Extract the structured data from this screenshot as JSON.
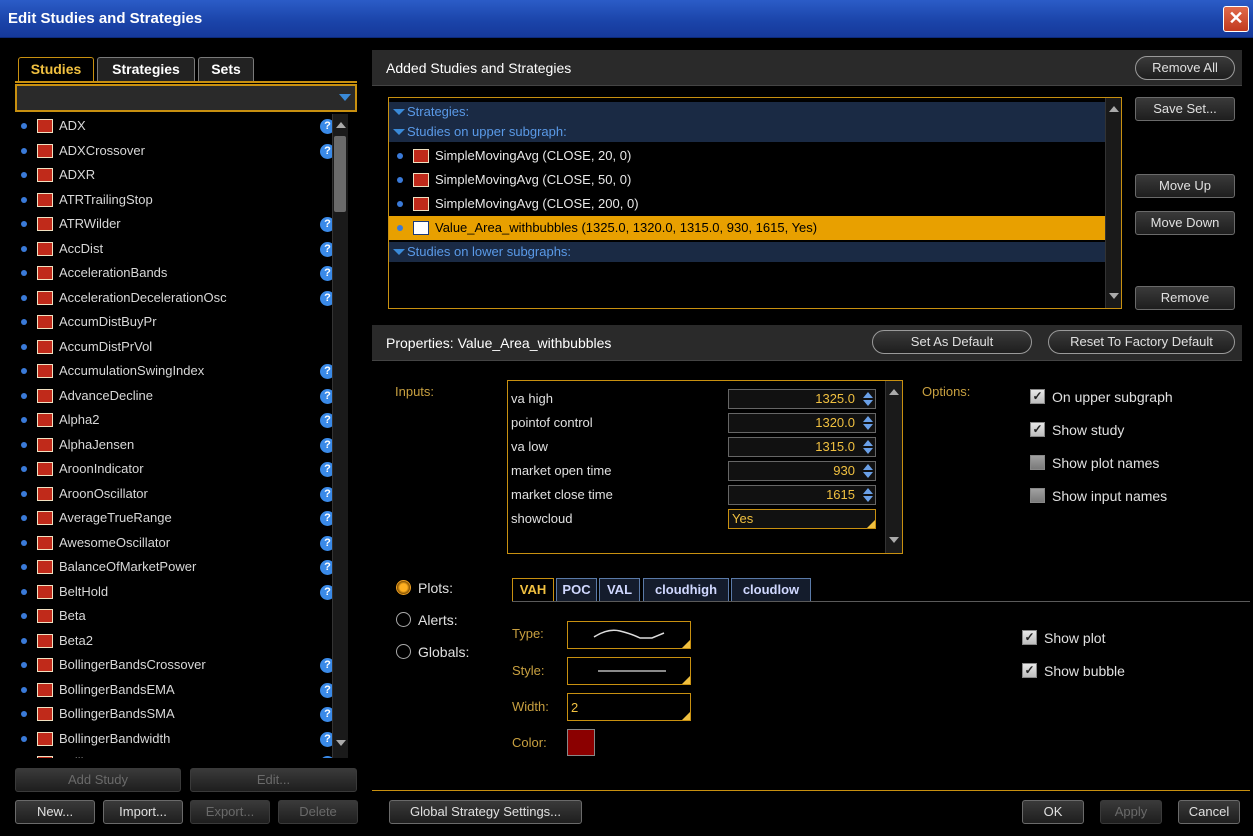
{
  "window": {
    "title": "Edit Studies and Strategies",
    "close_glyph": "✕"
  },
  "left": {
    "tabs": [
      "Studies",
      "Strategies",
      "Sets"
    ],
    "search_value": "",
    "studies": [
      {
        "name": "ADX",
        "help": true
      },
      {
        "name": "ADXCrossover",
        "help": true
      },
      {
        "name": "ADXR",
        "help": false
      },
      {
        "name": "ATRTrailingStop",
        "help": false
      },
      {
        "name": "ATRWilder",
        "help": true
      },
      {
        "name": "AccDist",
        "help": true
      },
      {
        "name": "AccelerationBands",
        "help": true
      },
      {
        "name": "AccelerationDecelerationOsc",
        "help": true
      },
      {
        "name": "AccumDistBuyPr",
        "help": false
      },
      {
        "name": "AccumDistPrVol",
        "help": false
      },
      {
        "name": "AccumulationSwingIndex",
        "help": true
      },
      {
        "name": "AdvanceDecline",
        "help": true
      },
      {
        "name": "Alpha2",
        "help": true
      },
      {
        "name": "AlphaJensen",
        "help": true
      },
      {
        "name": "AroonIndicator",
        "help": true
      },
      {
        "name": "AroonOscillator",
        "help": true
      },
      {
        "name": "AverageTrueRange",
        "help": true
      },
      {
        "name": "AwesomeOscillator",
        "help": true
      },
      {
        "name": "BalanceOfMarketPower",
        "help": true
      },
      {
        "name": "BeltHold",
        "help": true
      },
      {
        "name": "Beta",
        "help": false
      },
      {
        "name": "Beta2",
        "help": false
      },
      {
        "name": "BollingerBandsCrossover",
        "help": true
      },
      {
        "name": "BollingerBandsEMA",
        "help": true
      },
      {
        "name": "BollingerBandsSMA",
        "help": true
      },
      {
        "name": "BollingerBandwidth",
        "help": true
      },
      {
        "name": "BollingerPercentB",
        "help": true
      }
    ],
    "add_study_label": "Add Study",
    "edit_label": "Edit...",
    "new_label": "New...",
    "import_label": "Import...",
    "export_label": "Export...",
    "delete_label": "Delete"
  },
  "added": {
    "header": "Added Studies and Strategies",
    "remove_all": "Remove All",
    "save_set": "Save Set...",
    "move_up": "Move Up",
    "move_down": "Move Down",
    "remove": "Remove",
    "group_strategies": "Strategies:",
    "group_upper": "Studies on upper subgraph:",
    "group_lower": "Studies on lower subgraphs:",
    "items": [
      "SimpleMovingAvg (CLOSE, 20, 0)",
      "SimpleMovingAvg (CLOSE, 50, 0)",
      "SimpleMovingAvg (CLOSE, 200, 0)",
      "Value_Area_withbubbles (1325.0, 1320.0, 1315.0, 930, 1615, Yes)"
    ]
  },
  "properties": {
    "header": "Properties: Value_Area_withbubbles",
    "set_default": "Set As Default",
    "reset_factory": "Reset To Factory Default",
    "inputs_label": "Inputs:",
    "options_label": "Options:",
    "inputs": [
      {
        "name": "va high",
        "value": "1325.0"
      },
      {
        "name": "pointof control",
        "value": "1320.0"
      },
      {
        "name": "va low",
        "value": "1315.0"
      },
      {
        "name": "market open time",
        "value": "930"
      },
      {
        "name": "market close time",
        "value": "1615"
      },
      {
        "name": "showcloud",
        "value": "Yes"
      }
    ],
    "options": [
      {
        "label": "On upper subgraph",
        "checked": true
      },
      {
        "label": "Show study",
        "checked": true
      },
      {
        "label": "Show plot names",
        "checked": false
      },
      {
        "label": "Show input names",
        "checked": false
      }
    ],
    "radios": [
      "Plots:",
      "Alerts:",
      "Globals:"
    ],
    "plot_tabs": [
      "VAH",
      "POC",
      "VAL",
      "cloudhigh",
      "cloudlow"
    ],
    "type_label": "Type:",
    "style_label": "Style:",
    "width_label": "Width:",
    "width_value": "2",
    "color_label": "Color:",
    "plot_color": "#8b0000",
    "show_plot": "Show plot",
    "show_bubble": "Show bubble"
  },
  "footer": {
    "global_settings": "Global Strategy Settings...",
    "ok": "OK",
    "apply": "Apply",
    "cancel": "Cancel"
  }
}
